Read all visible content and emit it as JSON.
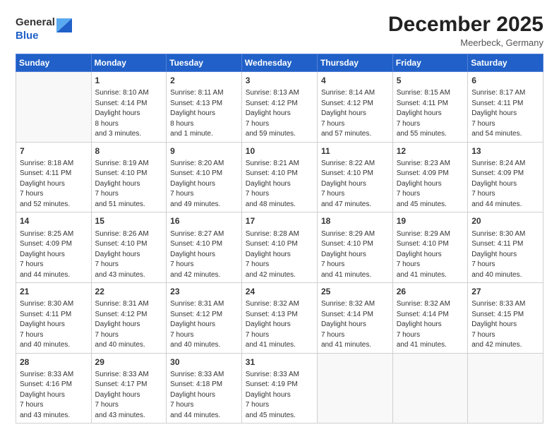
{
  "header": {
    "logo_general": "General",
    "logo_blue": "Blue",
    "month_title": "December 2025",
    "location": "Meerbeck, Germany"
  },
  "days_of_week": [
    "Sunday",
    "Monday",
    "Tuesday",
    "Wednesday",
    "Thursday",
    "Friday",
    "Saturday"
  ],
  "weeks": [
    [
      {
        "day": "",
        "empty": true
      },
      {
        "day": "1",
        "sunrise": "8:10 AM",
        "sunset": "4:14 PM",
        "daylight": "8 hours and 3 minutes."
      },
      {
        "day": "2",
        "sunrise": "8:11 AM",
        "sunset": "4:13 PM",
        "daylight": "8 hours and 1 minute."
      },
      {
        "day": "3",
        "sunrise": "8:13 AM",
        "sunset": "4:12 PM",
        "daylight": "7 hours and 59 minutes."
      },
      {
        "day": "4",
        "sunrise": "8:14 AM",
        "sunset": "4:12 PM",
        "daylight": "7 hours and 57 minutes."
      },
      {
        "day": "5",
        "sunrise": "8:15 AM",
        "sunset": "4:11 PM",
        "daylight": "7 hours and 55 minutes."
      },
      {
        "day": "6",
        "sunrise": "8:17 AM",
        "sunset": "4:11 PM",
        "daylight": "7 hours and 54 minutes."
      }
    ],
    [
      {
        "day": "7",
        "sunrise": "8:18 AM",
        "sunset": "4:11 PM",
        "daylight": "7 hours and 52 minutes."
      },
      {
        "day": "8",
        "sunrise": "8:19 AM",
        "sunset": "4:10 PM",
        "daylight": "7 hours and 51 minutes."
      },
      {
        "day": "9",
        "sunrise": "8:20 AM",
        "sunset": "4:10 PM",
        "daylight": "7 hours and 49 minutes."
      },
      {
        "day": "10",
        "sunrise": "8:21 AM",
        "sunset": "4:10 PM",
        "daylight": "7 hours and 48 minutes."
      },
      {
        "day": "11",
        "sunrise": "8:22 AM",
        "sunset": "4:10 PM",
        "daylight": "7 hours and 47 minutes."
      },
      {
        "day": "12",
        "sunrise": "8:23 AM",
        "sunset": "4:09 PM",
        "daylight": "7 hours and 45 minutes."
      },
      {
        "day": "13",
        "sunrise": "8:24 AM",
        "sunset": "4:09 PM",
        "daylight": "7 hours and 44 minutes."
      }
    ],
    [
      {
        "day": "14",
        "sunrise": "8:25 AM",
        "sunset": "4:09 PM",
        "daylight": "7 hours and 44 minutes."
      },
      {
        "day": "15",
        "sunrise": "8:26 AM",
        "sunset": "4:10 PM",
        "daylight": "7 hours and 43 minutes."
      },
      {
        "day": "16",
        "sunrise": "8:27 AM",
        "sunset": "4:10 PM",
        "daylight": "7 hours and 42 minutes."
      },
      {
        "day": "17",
        "sunrise": "8:28 AM",
        "sunset": "4:10 PM",
        "daylight": "7 hours and 42 minutes."
      },
      {
        "day": "18",
        "sunrise": "8:29 AM",
        "sunset": "4:10 PM",
        "daylight": "7 hours and 41 minutes."
      },
      {
        "day": "19",
        "sunrise": "8:29 AM",
        "sunset": "4:10 PM",
        "daylight": "7 hours and 41 minutes."
      },
      {
        "day": "20",
        "sunrise": "8:30 AM",
        "sunset": "4:11 PM",
        "daylight": "7 hours and 40 minutes."
      }
    ],
    [
      {
        "day": "21",
        "sunrise": "8:30 AM",
        "sunset": "4:11 PM",
        "daylight": "7 hours and 40 minutes."
      },
      {
        "day": "22",
        "sunrise": "8:31 AM",
        "sunset": "4:12 PM",
        "daylight": "7 hours and 40 minutes."
      },
      {
        "day": "23",
        "sunrise": "8:31 AM",
        "sunset": "4:12 PM",
        "daylight": "7 hours and 40 minutes."
      },
      {
        "day": "24",
        "sunrise": "8:32 AM",
        "sunset": "4:13 PM",
        "daylight": "7 hours and 41 minutes."
      },
      {
        "day": "25",
        "sunrise": "8:32 AM",
        "sunset": "4:14 PM",
        "daylight": "7 hours and 41 minutes."
      },
      {
        "day": "26",
        "sunrise": "8:32 AM",
        "sunset": "4:14 PM",
        "daylight": "7 hours and 41 minutes."
      },
      {
        "day": "27",
        "sunrise": "8:33 AM",
        "sunset": "4:15 PM",
        "daylight": "7 hours and 42 minutes."
      }
    ],
    [
      {
        "day": "28",
        "sunrise": "8:33 AM",
        "sunset": "4:16 PM",
        "daylight": "7 hours and 43 minutes."
      },
      {
        "day": "29",
        "sunrise": "8:33 AM",
        "sunset": "4:17 PM",
        "daylight": "7 hours and 43 minutes."
      },
      {
        "day": "30",
        "sunrise": "8:33 AM",
        "sunset": "4:18 PM",
        "daylight": "7 hours and 44 minutes."
      },
      {
        "day": "31",
        "sunrise": "8:33 AM",
        "sunset": "4:19 PM",
        "daylight": "7 hours and 45 minutes."
      },
      {
        "day": "",
        "empty": true
      },
      {
        "day": "",
        "empty": true
      },
      {
        "day": "",
        "empty": true
      }
    ]
  ],
  "labels": {
    "sunrise": "Sunrise:",
    "sunset": "Sunset:",
    "daylight": "Daylight hours"
  }
}
